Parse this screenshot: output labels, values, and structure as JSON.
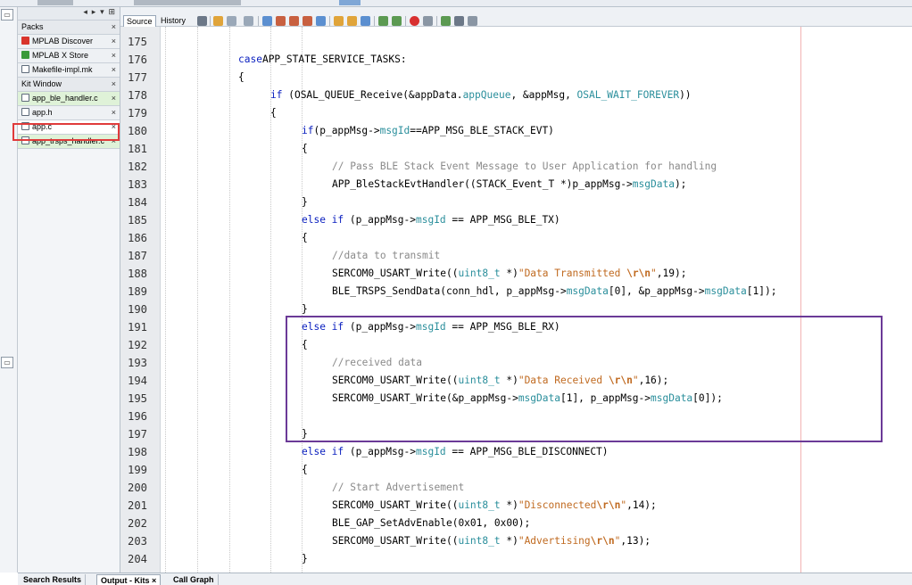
{
  "tabs_panel": {
    "items": [
      {
        "label": "Packs",
        "kind": "group",
        "icon": ""
      },
      {
        "label": "MPLAB Discover",
        "kind": "file",
        "icon": "discover-icon"
      },
      {
        "label": "MPLAB X Store",
        "kind": "file",
        "icon": "store-icon"
      },
      {
        "label": "Makefile-impl.mk",
        "kind": "file",
        "icon": "file-icon"
      },
      {
        "label": "Kit Window",
        "kind": "group",
        "icon": ""
      },
      {
        "label": "app_ble_handler.c",
        "kind": "green",
        "icon": "c-file-icon"
      },
      {
        "label": "app.h",
        "kind": "file",
        "icon": "h-file-icon"
      },
      {
        "label": "app.c",
        "kind": "active",
        "icon": "c-file-icon"
      },
      {
        "label": "app_trsps_handler.c",
        "kind": "green",
        "icon": "c-file-icon"
      }
    ]
  },
  "editor": {
    "view_tabs": [
      "Source",
      "History"
    ],
    "active_view": "Source"
  },
  "bottom_tabs": [
    {
      "label": "Search Results",
      "active": false
    },
    {
      "label": "Output - Kits",
      "active": true
    },
    {
      "label": "Call Graph",
      "active": false
    }
  ],
  "annotations": {
    "highlight_color": "#e03b3b",
    "box_color": "#6b3a97"
  },
  "code": {
    "lines": [
      {
        "n": "175",
        "indent": 0,
        "t": []
      },
      {
        "n": "176",
        "indent": 2,
        "t": [
          [
            "k",
            "case"
          ],
          [
            "",
            "APP_STATE_SERVICE_TASKS:"
          ]
        ]
      },
      {
        "n": "177",
        "indent": 2,
        "t": [
          [
            "",
            "{"
          ]
        ]
      },
      {
        "n": "178",
        "indent": 3,
        "t": [
          [
            "k",
            "if"
          ],
          [
            "",
            " (OSAL_QUEUE_Receive(&appData."
          ],
          [
            "f",
            "appQueue"
          ],
          [
            "",
            ", &appMsg, "
          ],
          [
            "f",
            "OSAL_WAIT_FOREVER"
          ],
          [
            "",
            "))"
          ]
        ]
      },
      {
        "n": "179",
        "indent": 3,
        "t": [
          [
            "",
            "{"
          ]
        ]
      },
      {
        "n": "180",
        "indent": 4,
        "t": [
          [
            "k",
            "if"
          ],
          [
            "",
            "(p_appMsg->"
          ],
          [
            "f",
            "msgId"
          ],
          [
            "",
            "==APP_MSG_BLE_STACK_EVT)"
          ]
        ]
      },
      {
        "n": "181",
        "indent": 4,
        "t": [
          [
            "",
            "{"
          ]
        ]
      },
      {
        "n": "182",
        "indent": 5,
        "t": [
          [
            "c",
            "// Pass BLE Stack Event Message to User Application for handling"
          ]
        ]
      },
      {
        "n": "183",
        "indent": 5,
        "t": [
          [
            "",
            "APP_BleStackEvtHandler((STACK_Event_T *)p_appMsg->"
          ],
          [
            "f",
            "msgData"
          ],
          [
            "",
            ");"
          ]
        ]
      },
      {
        "n": "184",
        "indent": 4,
        "t": [
          [
            "",
            "}"
          ]
        ]
      },
      {
        "n": "185",
        "indent": 4,
        "t": [
          [
            "k",
            "else if"
          ],
          [
            "",
            " (p_appMsg->"
          ],
          [
            "f",
            "msgId"
          ],
          [
            "",
            " == APP_MSG_BLE_TX)"
          ]
        ]
      },
      {
        "n": "186",
        "indent": 4,
        "t": [
          [
            "",
            "{"
          ]
        ]
      },
      {
        "n": "187",
        "indent": 5,
        "t": [
          [
            "c",
            "//data to transmit"
          ]
        ]
      },
      {
        "n": "188",
        "indent": 5,
        "t": [
          [
            "",
            "SERCOM0_USART_Write(("
          ],
          [
            "f",
            "uint8_t"
          ],
          [
            "",
            " *)"
          ],
          [
            "s",
            "\"Data Transmitted "
          ],
          [
            "e",
            "\\r\\n"
          ],
          [
            "s",
            "\""
          ],
          [
            "",
            ",19);"
          ]
        ]
      },
      {
        "n": "189",
        "indent": 5,
        "t": [
          [
            "",
            "BLE_TRSPS_SendData(conn_hdl, p_appMsg->"
          ],
          [
            "f",
            "msgData"
          ],
          [
            "",
            "[0], &p_appMsg->"
          ],
          [
            "f",
            "msgData"
          ],
          [
            "",
            "[1]);"
          ]
        ]
      },
      {
        "n": "190",
        "indent": 4,
        "t": [
          [
            "",
            "}"
          ]
        ]
      },
      {
        "n": "191",
        "indent": 4,
        "t": [
          [
            "k",
            "else if"
          ],
          [
            "",
            " (p_appMsg->"
          ],
          [
            "f",
            "msgId"
          ],
          [
            "",
            " == APP_MSG_BLE_RX)"
          ]
        ]
      },
      {
        "n": "192",
        "indent": 4,
        "t": [
          [
            "",
            "{"
          ]
        ]
      },
      {
        "n": "193",
        "indent": 5,
        "t": [
          [
            "c",
            "//received data"
          ]
        ]
      },
      {
        "n": "194",
        "indent": 5,
        "t": [
          [
            "",
            "SERCOM0_USART_Write(("
          ],
          [
            "f",
            "uint8_t"
          ],
          [
            "",
            " *)"
          ],
          [
            "s",
            "\"Data Received "
          ],
          [
            "e",
            "\\r\\n"
          ],
          [
            "s",
            "\""
          ],
          [
            "",
            ",16);"
          ]
        ]
      },
      {
        "n": "195",
        "indent": 5,
        "t": [
          [
            "",
            "SERCOM0_USART_Write(&p_appMsg->"
          ],
          [
            "f",
            "msgData"
          ],
          [
            "",
            "[1], p_appMsg->"
          ],
          [
            "f",
            "msgData"
          ],
          [
            "",
            "[0]);"
          ]
        ]
      },
      {
        "n": "196",
        "indent": 0,
        "t": []
      },
      {
        "n": "197",
        "indent": 4,
        "t": [
          [
            "",
            "}"
          ]
        ]
      },
      {
        "n": "198",
        "indent": 4,
        "t": [
          [
            "k",
            "else if"
          ],
          [
            "",
            " (p_appMsg->"
          ],
          [
            "f",
            "msgId"
          ],
          [
            "",
            " == APP_MSG_BLE_DISCONNECT)"
          ]
        ]
      },
      {
        "n": "199",
        "indent": 4,
        "t": [
          [
            "",
            "{"
          ]
        ]
      },
      {
        "n": "200",
        "indent": 5,
        "t": [
          [
            "c",
            "// Start Advertisement"
          ]
        ]
      },
      {
        "n": "201",
        "indent": 5,
        "t": [
          [
            "",
            "SERCOM0_USART_Write(("
          ],
          [
            "f",
            "uint8_t"
          ],
          [
            "",
            " *)"
          ],
          [
            "s",
            "\"Disconnected"
          ],
          [
            "e",
            "\\r\\n"
          ],
          [
            "s",
            "\""
          ],
          [
            "",
            ",14);"
          ]
        ]
      },
      {
        "n": "202",
        "indent": 5,
        "t": [
          [
            "",
            "BLE_GAP_SetAdvEnable(0x01, 0x00);"
          ]
        ]
      },
      {
        "n": "203",
        "indent": 5,
        "t": [
          [
            "",
            "SERCOM0_USART_Write(("
          ],
          [
            "f",
            "uint8_t"
          ],
          [
            "",
            " *)"
          ],
          [
            "s",
            "\"Advertising"
          ],
          [
            "e",
            "\\r\\n"
          ],
          [
            "s",
            "\""
          ],
          [
            "",
            ",13);"
          ]
        ]
      },
      {
        "n": "204",
        "indent": 4,
        "t": [
          [
            "",
            "}"
          ]
        ]
      }
    ]
  }
}
